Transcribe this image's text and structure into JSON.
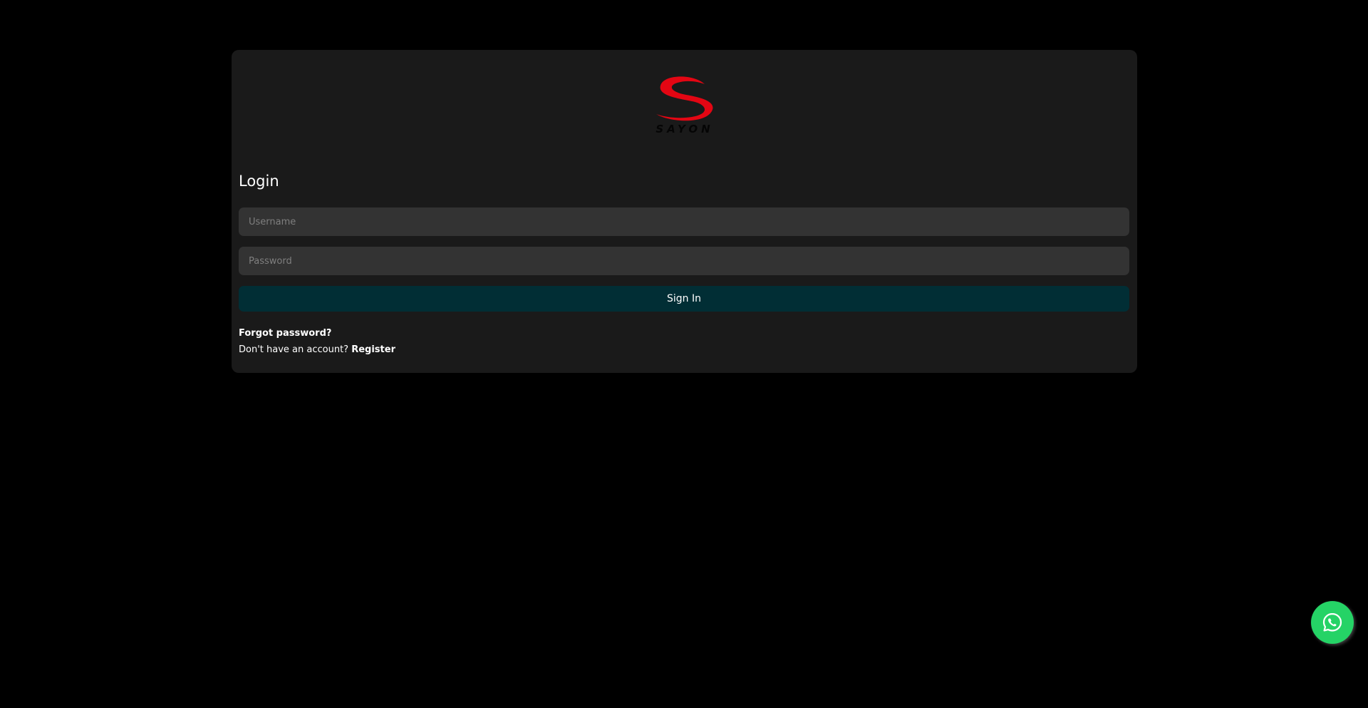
{
  "brand": {
    "logo_text": "SAYON",
    "logo_color": "#e30613"
  },
  "login": {
    "title": "Login",
    "username_placeholder": "Username",
    "password_placeholder": "Password",
    "sign_in_label": "Sign In",
    "forgot_label": "Forgot password?",
    "no_account_text": "Don't have an account?",
    "register_label": "Register"
  },
  "floating": {
    "whatsapp_icon": "whatsapp-icon",
    "whatsapp_color": "#25d366"
  },
  "colors": {
    "background": "#000000",
    "card": "#1a1a1a",
    "input": "#333333",
    "button": "#012e35"
  }
}
